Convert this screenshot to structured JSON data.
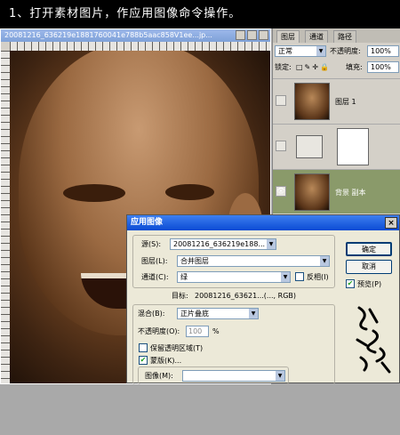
{
  "banner": {
    "text": "1、打开素材图片，作应用图像命令操作。"
  },
  "document": {
    "title": "20081216_636219e1881760041e788b5aac858V1ee...jp..."
  },
  "layers_panel": {
    "tabs": [
      "图层",
      "通道",
      "路径"
    ],
    "blend_mode": "正常",
    "opacity_label": "不透明度:",
    "opacity_value": "100%",
    "lock_label": "锁定:",
    "fill_label": "填充:",
    "fill_value": "100%",
    "layers": [
      {
        "name": "图层 1",
        "active": false
      },
      {
        "name": "",
        "active": false
      },
      {
        "name": "背景 副本",
        "active": true
      }
    ]
  },
  "dialog": {
    "title": "应用图像",
    "close_glyph": "×",
    "source_label": "源(S):",
    "source_value": "20081216_636219e188...",
    "layer_label": "图层(L):",
    "layer_value": "合并图层",
    "channel_label": "通道(C):",
    "channel_value": "绿",
    "invert_label": "反相(I)",
    "target_label": "目标:",
    "target_value": "20081216_63621...(..., RGB)",
    "blending_label": "混合(B):",
    "blending_value": "正片叠底",
    "opacity_label": "不透明度(O):",
    "opacity_value": "100",
    "opacity_unit": "%",
    "preserve_label": "保留透明区域(T)",
    "mask_label": "蒙版(K)...",
    "image_label": "图像(M):",
    "ok_label": "确定",
    "cancel_label": "取消",
    "preview_label": "预览(P)"
  },
  "colors": {
    "title_blue": "#0a4bd4",
    "layer_active": "#8a9a6a"
  }
}
